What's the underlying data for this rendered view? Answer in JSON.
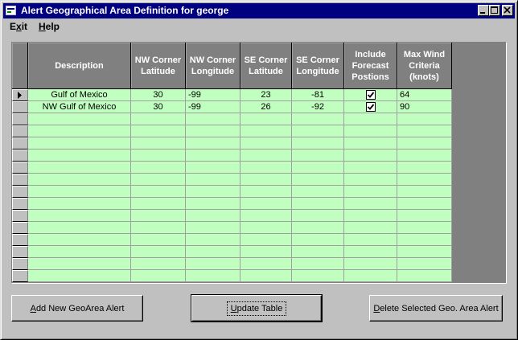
{
  "window": {
    "title": "Alert Geographical Area Definition for george"
  },
  "menu": [
    {
      "label": "Exit",
      "accel": "x"
    },
    {
      "label": "Help",
      "accel": "H"
    }
  ],
  "grid": {
    "columns": [
      {
        "key": "description",
        "label": "Description",
        "align": "center"
      },
      {
        "key": "nw_lat",
        "label": "NW Corner Latitude",
        "align": "center"
      },
      {
        "key": "nw_lon",
        "label": "NW Corner Longitude",
        "align": "left"
      },
      {
        "key": "se_lat",
        "label": "SE Corner Latitude",
        "align": "center"
      },
      {
        "key": "se_lon",
        "label": "SE Corner Longitude",
        "align": "center"
      },
      {
        "key": "forecast",
        "label": "Include Forecast Postions",
        "align": "center"
      },
      {
        "key": "max_wind",
        "label": "Max Wind Criteria (knots)",
        "align": "left"
      }
    ],
    "rows": [
      {
        "description": "Gulf of Mexico",
        "nw_lat": "30",
        "nw_lon": "-99",
        "se_lat": "23",
        "se_lon": "-81",
        "forecast": true,
        "max_wind": "64"
      },
      {
        "description": "NW Gulf of Mexico",
        "nw_lat": "30",
        "nw_lon": "-99",
        "se_lat": "26",
        "se_lon": "-92",
        "forecast": true,
        "max_wind": "90"
      }
    ],
    "current_row": 0,
    "cell_color": "#c0ffc0"
  },
  "buttons": {
    "add": "Add New GeoArea Alert",
    "update": "Update Table",
    "delete": "Delete Selected Geo. Area Alert"
  }
}
